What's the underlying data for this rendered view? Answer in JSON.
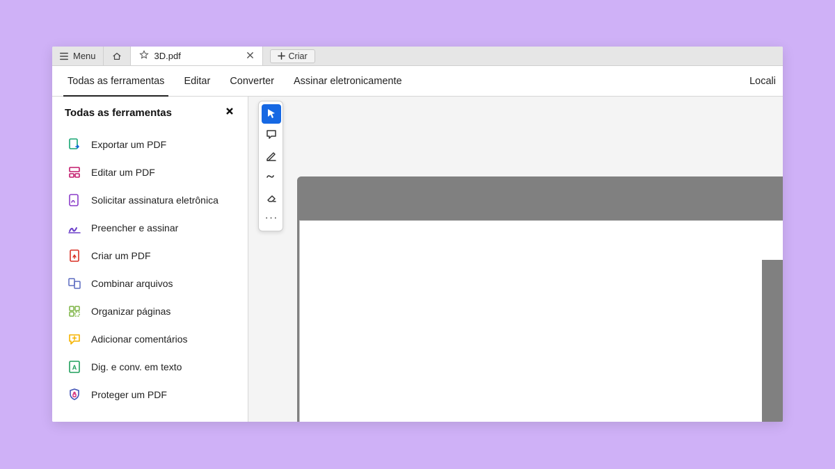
{
  "titlebar": {
    "menu_label": "Menu",
    "tab_title": "3D.pdf",
    "create_label": "Criar"
  },
  "navbar": {
    "items": [
      "Todas as ferramentas",
      "Editar",
      "Converter",
      "Assinar eletronicamente"
    ],
    "right_label": "Locali"
  },
  "sidebar": {
    "title": "Todas as ferramentas",
    "tools": [
      {
        "label": "Exportar um PDF"
      },
      {
        "label": "Editar um PDF"
      },
      {
        "label": "Solicitar assinatura eletrônica"
      },
      {
        "label": "Preencher e assinar"
      },
      {
        "label": "Criar um PDF"
      },
      {
        "label": "Combinar arquivos"
      },
      {
        "label": "Organizar páginas"
      },
      {
        "label": "Adicionar comentários"
      },
      {
        "label": "Dig. e conv. em texto"
      },
      {
        "label": "Proteger um PDF"
      }
    ]
  },
  "colors": {
    "accent": "#1668e3",
    "export": "#17a673",
    "edit": "#c2186b",
    "sign": "#8a3cc9",
    "fill": "#6b3fc9",
    "create": "#d93025",
    "combine": "#5c6bc0",
    "organize": "#7cb342",
    "comment": "#f5b300",
    "ocr": "#1e9e5a",
    "protect": "#3f51b5"
  }
}
